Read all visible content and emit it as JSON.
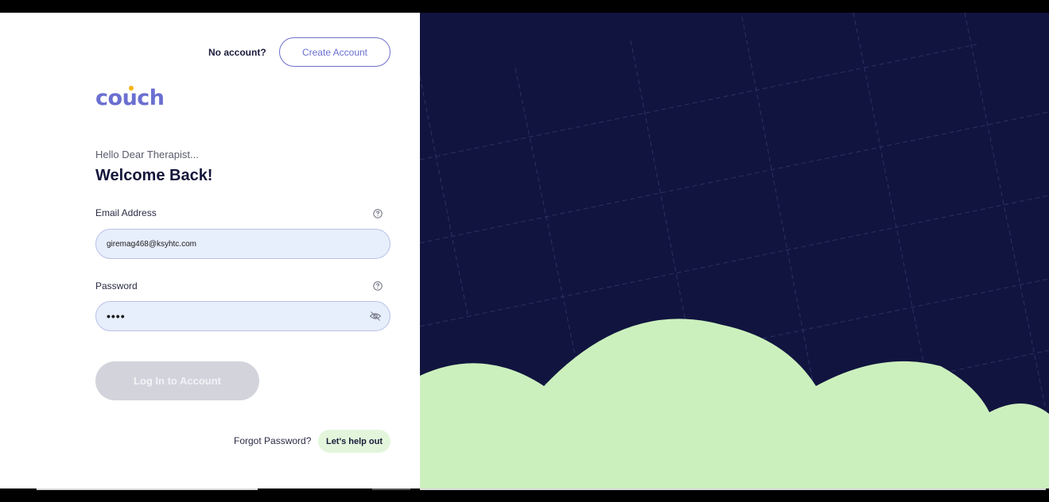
{
  "header": {
    "no_account_text": "No account?",
    "create_account_label": "Create Account"
  },
  "brand": {
    "logo_text_left": "co",
    "logo_text_u": "u",
    "logo_text_right": "ch"
  },
  "intro": {
    "greeting": "Hello Dear Therapist...",
    "title": "Welcome Back!"
  },
  "form": {
    "email_label": "Email Address",
    "email_value": "giremag468@ksyhtc.com",
    "password_label": "Password",
    "password_value": "••••",
    "login_label": "Log In to Account"
  },
  "footer": {
    "forgot_text": "Forgot Password?",
    "help_label": "Let's help out"
  },
  "colors": {
    "accent": "#6b6fd0",
    "panel_bg": "#11143f",
    "cloud": "#ccf0bd",
    "input_bg": "#e7eefc"
  }
}
